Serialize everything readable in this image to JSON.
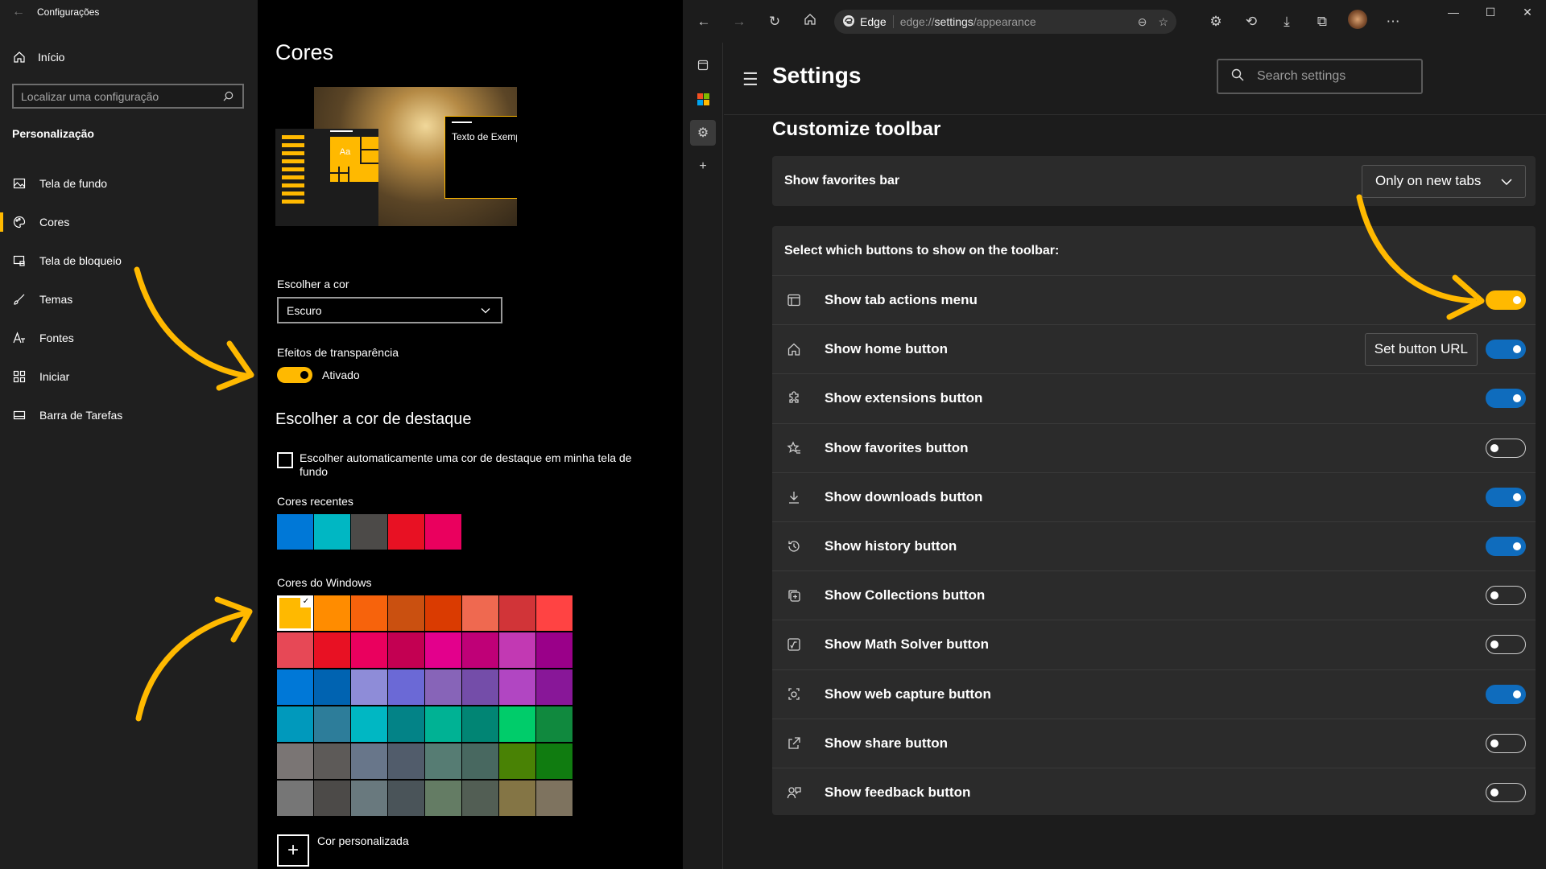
{
  "win": {
    "app_title": "Configurações",
    "home": "Início",
    "search_placeholder": "Localizar uma configuração",
    "section": "Personalização",
    "nav": [
      {
        "label": "Tela de fundo",
        "icon": "image-icon"
      },
      {
        "label": "Cores",
        "icon": "palette-icon",
        "active": true
      },
      {
        "label": "Tela de bloqueio",
        "icon": "lockscreen-icon"
      },
      {
        "label": "Temas",
        "icon": "brush-icon"
      },
      {
        "label": "Fontes",
        "icon": "font-icon"
      },
      {
        "label": "Iniciar",
        "icon": "start-icon"
      },
      {
        "label": "Barra de Tarefas",
        "icon": "taskbar-icon"
      }
    ],
    "page_title": "Cores",
    "preview_tile": "Aa",
    "preview_sample": "Texto de Exemplo",
    "choose_color_label": "Escolher a cor",
    "choose_color_value": "Escuro",
    "transparency_label": "Efeitos de transparência",
    "transparency_value": "Ativado",
    "accent_title": "Escolher a cor de destaque",
    "auto_accent_label": "Escolher automaticamente uma cor de destaque em minha tela de fundo",
    "recent_label": "Cores recentes",
    "recent_colors": [
      "#0078d7",
      "#00b7c3",
      "#4c4a48",
      "#e81123",
      "#ea005e"
    ],
    "windows_colors_label": "Cores do Windows",
    "windows_colors": [
      "#ffb900",
      "#ff8c00",
      "#f7630c",
      "#ca5010",
      "#da3b01",
      "#ef6950",
      "#d13438",
      "#ff4343",
      "#e74856",
      "#e81123",
      "#ea005e",
      "#c30052",
      "#e3008c",
      "#bf0077",
      "#c239b3",
      "#9a0089",
      "#0078d7",
      "#0063b1",
      "#8e8cd8",
      "#6b69d6",
      "#8764b8",
      "#744da9",
      "#b146c2",
      "#881798",
      "#0099bc",
      "#2d7d9a",
      "#00b7c3",
      "#038387",
      "#00b294",
      "#018574",
      "#00cc6a",
      "#10893e",
      "#7a7574",
      "#5d5a58",
      "#68768a",
      "#515c6b",
      "#567c73",
      "#486860",
      "#498205",
      "#107c10",
      "#767676",
      "#4c4a48",
      "#69797e",
      "#4a5459",
      "#647c64",
      "#525e54",
      "#847545",
      "#7e735f"
    ],
    "selected_color_index": 0,
    "custom_color_label": "Cor personalizada"
  },
  "edge": {
    "brand": "Edge",
    "url_prefix": "edge://",
    "url_host": "settings",
    "url_path": "/appearance",
    "settings_title": "Settings",
    "search_placeholder": "Search settings",
    "section_title": "Customize toolbar",
    "favorites_bar_label": "Show favorites bar",
    "favorites_bar_value": "Only on new tabs",
    "buttons_header": "Select which buttons to show on the toolbar:",
    "set_button_url": "Set button URL",
    "rows": [
      {
        "label": "Show tab actions menu",
        "icon": "tab-actions-icon",
        "on": true,
        "accent": "#ffb900"
      },
      {
        "label": "Show home button",
        "icon": "home-icon",
        "on": true
      },
      {
        "label": "Show extensions button",
        "icon": "extensions-icon",
        "on": true
      },
      {
        "label": "Show favorites button",
        "icon": "favorites-icon",
        "on": false
      },
      {
        "label": "Show downloads button",
        "icon": "downloads-icon",
        "on": true
      },
      {
        "label": "Show history button",
        "icon": "history-icon",
        "on": true
      },
      {
        "label": "Show Collections button",
        "icon": "collections-icon",
        "on": false
      },
      {
        "label": "Show Math Solver button",
        "icon": "math-solver-icon",
        "on": false
      },
      {
        "label": "Show web capture button",
        "icon": "web-capture-icon",
        "on": true
      },
      {
        "label": "Show share button",
        "icon": "share-icon",
        "on": false
      },
      {
        "label": "Show feedback button",
        "icon": "feedback-icon",
        "on": false
      }
    ]
  },
  "colors": {
    "accent_yellow": "#ffb900",
    "toggle_blue": "#0f6cbd"
  }
}
